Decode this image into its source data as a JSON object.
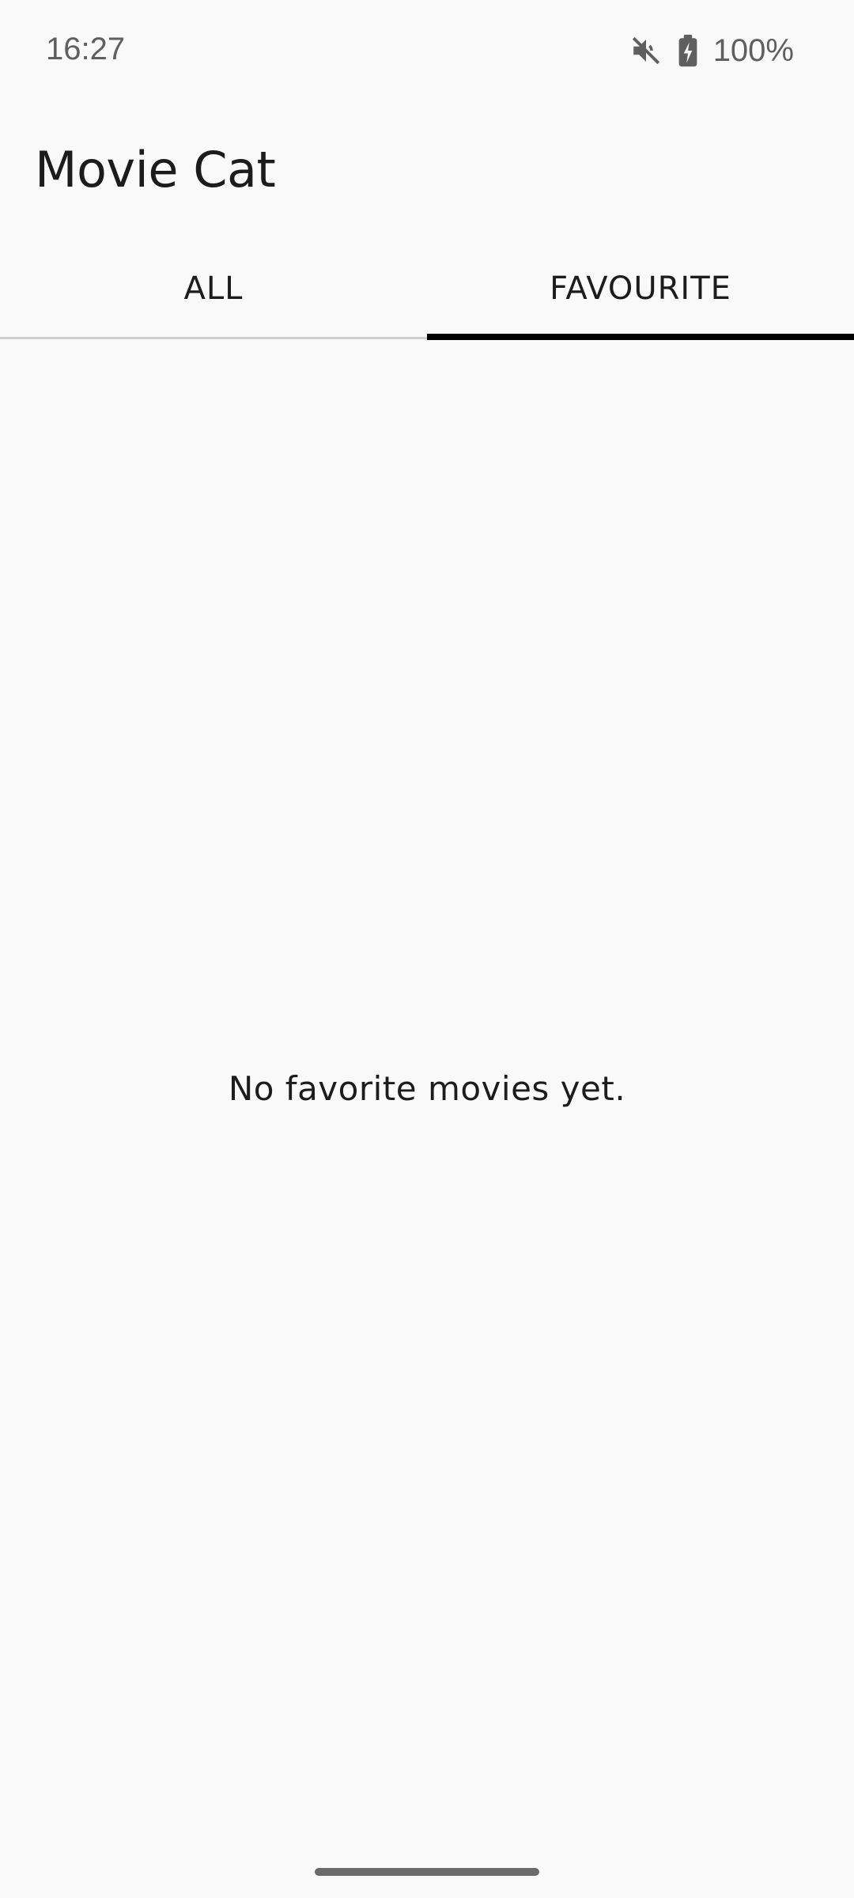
{
  "status_bar": {
    "time": "16:27",
    "icons": [
      "mute-icon",
      "battery-charging-icon"
    ],
    "battery": "100%"
  },
  "app": {
    "title": "Movie Cat"
  },
  "tabs": [
    {
      "label": "ALL",
      "selected": false
    },
    {
      "label": "FAVOURITE",
      "selected": true
    }
  ],
  "content": {
    "empty_message": "No favorite movies yet."
  },
  "colors": {
    "background": "#f9f9f9",
    "text": "#1c1c1c",
    "indicator": "#000000"
  }
}
